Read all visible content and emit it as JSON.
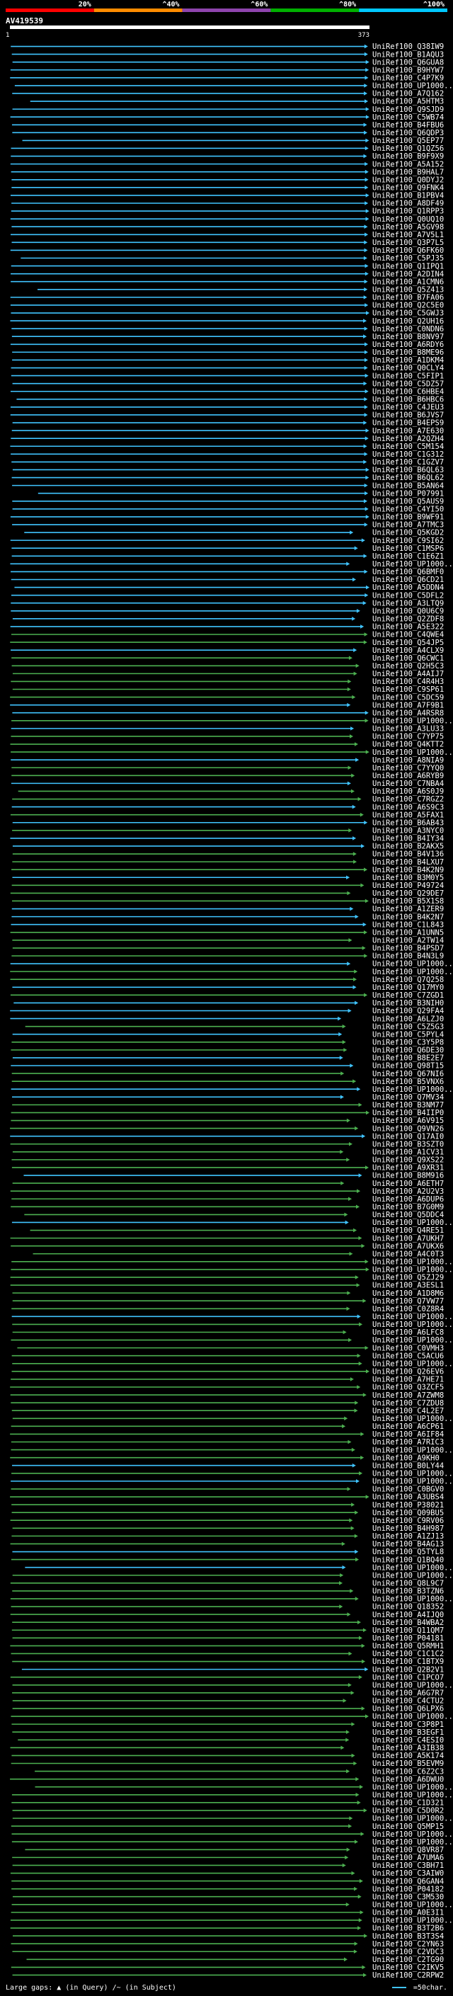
{
  "query_name": "AV419539",
  "query_start": "1",
  "query_end": "373",
  "scale_labels": [
    "20%",
    "^40%",
    "^60%",
    "^80%",
    "^100%"
  ],
  "scale_colors": [
    "#ff0000",
    "#ff8c00",
    "#8e44ad",
    "#00b000",
    "#00c8ff"
  ],
  "hit_colors": {
    "high": "#40c4ff",
    "mid": "#4caf50"
  },
  "footer": {
    "gaps_label": "Large gaps:",
    "gap_query_label": "(in Query)",
    "gap_subject_label": "(in Subject)",
    "key_label": "=50char."
  },
  "hits": [
    "UniRef100_Q38IW9",
    "UniRef100_B1AQU3",
    "UniRef100_Q6GUA8",
    "UniRef100_B9HYW7",
    "UniRef100_C4P7K9",
    "UniRef100_UP1000...",
    "UniRef100_A7Q162",
    "UniRef100_A5HTM3",
    "UniRef100_Q9SJD9",
    "UniRef100_C5WB74",
    "UniRef100_B4FBU6",
    "UniRef100_Q6QDP3",
    "UniRef100_Q5EP77",
    "UniRef100_Q1QZ56",
    "UniRef100_B9F9X9",
    "UniRef100_A5A152",
    "UniRef100_B9HAL7",
    "UniRef100_Q0DYJ2",
    "UniRef100_Q9FNK4",
    "UniRef100_B1PBV4",
    "UniRef100_A8DF49",
    "UniRef100_Q1RPP3",
    "UniRef100_Q0UQ10",
    "UniRef100_A5GV98",
    "UniRef100_A7V5L1",
    "UniRef100_Q3P7L5",
    "UniRef100_Q6FK60",
    "UniRef100_C5PJ35",
    "UniRef100_Q1IPQ1",
    "UniRef100_A2DIN4",
    "UniRef100_A1CMN6",
    "UniRef100_Q5Z413",
    "UniRef100_B7FA06",
    "UniRef100_Q2C5E0",
    "UniRef100_C5GWJ3",
    "UniRef100_Q2UH16",
    "UniRef100_C0NDN6",
    "UniRef100_B8NV97",
    "UniRef100_A6RDY6",
    "UniRef100_B8ME96",
    "UniRef100_A1DKM4",
    "UniRef100_Q0CLY4",
    "UniRef100_C5FIP1",
    "UniRef100_C5DZ57",
    "UniRef100_C6HBE4",
    "UniRef100_B6HBC6",
    "UniRef100_C4JEU3",
    "UniRef100_B6JVS7",
    "UniRef100_B4EPS9",
    "UniRef100_A7E630",
    "UniRef100_A2QZH4",
    "UniRef100_C5M154",
    "UniRef100_C1G312",
    "UniRef100_C1GZV7",
    "UniRef100_B6QL63",
    "UniRef100_B6QL62",
    "UniRef100_B5AN64",
    "UniRef100_P07991",
    "UniRef100_Q5AUS9",
    "UniRef100_C4YI50",
    "UniRef100_B9WF91",
    "UniRef100_A7TMC3",
    "UniRef100_Q5KGD2",
    "UniRef100_C9SI62",
    "UniRef100_C1MSP6",
    "UniRef100_C1E6Z1",
    "UniRef100_UP1000...",
    "UniRef100_Q6BMF0",
    "UniRef100_Q6CD21",
    "UniRef100_A5DDN4",
    "UniRef100_C5DFL2",
    "UniRef100_A3LTQ9",
    "UniRef100_Q0U6C9",
    "UniRef100_Q2ZDF8",
    "UniRef100_A5E322",
    "UniRef100_C4QWE4",
    "UniRef100_Q54JP5",
    "UniRef100_A4CLX9",
    "UniRef100_Q6CWC1",
    "UniRef100_Q2H5C3",
    "UniRef100_A4AIJ7",
    "UniRef100_C4R4H3",
    "UniRef100_C9SP61",
    "UniRef100_C5DC59",
    "UniRef100_A7F9B1",
    "UniRef100_A4RSR8",
    "UniRef100_UP1000...",
    "UniRef100_A3LU33",
    "UniRef100_C7YP75",
    "UniRef100_Q4KTT2",
    "UniRef100_UP1000...",
    "UniRef100_A8NIA9",
    "UniRef100_C7YYQ0",
    "UniRef100_A6RYB9",
    "UniRef100_C7NBA4",
    "UniRef100_A6S0J9",
    "UniRef100_C7RGZ2",
    "UniRef100_A6S9C3",
    "UniRef100_A5FAX1",
    "UniRef100_B6AB43",
    "UniRef100_A3NYC0",
    "UniRef100_B4IY34",
    "UniRef100_B2AKX5",
    "UniRef100_B4V136",
    "UniRef100_B4LXU7",
    "UniRef100_B4K2N9",
    "UniRef100_B3M0Y5",
    "UniRef100_P49724",
    "UniRef100_Q29DE7",
    "UniRef100_B5X1S8",
    "UniRef100_A1ZER9",
    "UniRef100_B4K2N7",
    "UniRef100_C1L843",
    "UniRef100_A1UNN5",
    "UniRef100_A2TW14",
    "UniRef100_B4PSD7",
    "UniRef100_B4N3L9",
    "UniRef100_UP1000...",
    "UniRef100_UP1000...",
    "UniRef100_Q7Q258",
    "UniRef100_Q17MY0",
    "UniRef100_C7ZGD1",
    "UniRef100_B3NIH0",
    "UniRef100_Q29FA4",
    "UniRef100_A6LZJ0",
    "UniRef100_C5Z5G3",
    "UniRef100_C5PYL4",
    "UniRef100_C3Y5P8",
    "UniRef100_Q6DE30",
    "UniRef100_B8E2E7",
    "UniRef100_Q98T15",
    "UniRef100_Q67NI6",
    "UniRef100_B5VNX6",
    "UniRef100_UP1000...",
    "UniRef100_Q7MV34",
    "UniRef100_B3NM77",
    "UniRef100_B4IIP0",
    "UniRef100_A6V915",
    "UniRef100_Q9VN26",
    "UniRef100_Q17AI0",
    "UniRef100_B3SZT0",
    "UniRef100_A1CV31",
    "UniRef100_Q9XS22",
    "UniRef100_A9XR31",
    "UniRef100_B8M916",
    "UniRef100_A6ETH7",
    "UniRef100_A2U2V3",
    "UniRef100_A6DUP6",
    "UniRef100_B7G0M9",
    "UniRef100_Q5DDC4",
    "UniRef100_UP1000...",
    "UniRef100_Q4RE51",
    "UniRef100_A7UKH7",
    "UniRef100_A7UKX6",
    "UniRef100_A4C0T3",
    "UniRef100_UP1000...",
    "UniRef100_UP1000...",
    "UniRef100_Q5ZJ29",
    "UniRef100_A3ESL1",
    "UniRef100_A1D8M6",
    "UniRef100_Q7VW77",
    "UniRef100_C0Z8R4",
    "UniRef100_UP1000...",
    "UniRef100_UP1000...",
    "UniRef100_A6LFC8",
    "UniRef100_UP1000...",
    "UniRef100_C0VMH3",
    "UniRef100_C5ACU6",
    "UniRef100_UP1000...",
    "UniRef100_Q26EV6",
    "UniRef100_A7HE71",
    "UniRef100_Q3ZCF5",
    "UniRef100_A7ZWM8",
    "UniRef100_C7ZDU8",
    "UniRef100_C4L2E7",
    "UniRef100_UP1000...",
    "UniRef100_A6CP61",
    "UniRef100_A6IF84",
    "UniRef100_A7RIC3",
    "UniRef100_UP1000...",
    "UniRef100_A9KH0",
    "UniRef100_B0LY44",
    "UniRef100_UP1000...",
    "UniRef100_UP1000...",
    "UniRef100_C0BGV0",
    "UniRef100_A3UBS4",
    "UniRef100_P38021",
    "UniRef100_Q09BU5",
    "UniRef100_C9RV06",
    "UniRef100_B4H987",
    "UniRef100_A1ZJ13",
    "UniRef100_B4AG13",
    "UniRef100_Q5TYL8",
    "UniRef100_Q1BQ40",
    "UniRef100_UP1000...",
    "UniRef100_UP1000...",
    "UniRef100_Q8L9C7",
    "UniRef100_B3TZN6",
    "UniRef100_UP1000...",
    "UniRef100_Q18352",
    "UniRef100_A4IJQ0",
    "UniRef100_B4WBA2",
    "UniRef100_Q11QM7",
    "UniRef100_P04181",
    "UniRef100_Q5RMH1",
    "UniRef100_C1C1C2",
    "UniRef100_C1BTX9",
    "UniRef100_Q2B2V1",
    "UniRef100_C1PCO7",
    "UniRef100_UP1000...",
    "UniRef100_A6G7R7",
    "UniRef100_C4CTU2",
    "UniRef100_Q6LPX6",
    "UniRef100_UP1000...",
    "UniRef100_C3P8P1",
    "UniRef100_B3EGF1",
    "UniRef100_C4ESI0",
    "UniRef100_A3IB38",
    "UniRef100_A5K174",
    "UniRef100_B5EVM9",
    "UniRef100_C6Z2C3",
    "UniRef100_A6DWU0",
    "UniRef100_UP1000...",
    "UniRef100_UP1000...",
    "UniRef100_C1D321",
    "UniRef100_C5D0R2",
    "UniRef100_UP1000...",
    "UniRef100_Q5MP15",
    "UniRef100_UP1000...",
    "UniRef100_UP1000...",
    "UniRef100_Q8VR87",
    "UniRef100_A7UMA6",
    "UniRef100_C3BH71",
    "UniRef100_C3AIW0",
    "UniRef100_Q6GAN4",
    "UniRef100_P04182",
    "UniRef100_C3M530",
    "UniRef100_UP1000...",
    "UniRef100_A0E3I1",
    "UniRef100_UP1000...",
    "UniRef100_B3T2B6",
    "UniRef100_B3T3S4",
    "UniRef100_C2YN63",
    "UniRef100_C2VDC3",
    "UniRef100_C2TG90",
    "UniRef100_C2IKV5",
    "UniRef100_C2RPW2"
  ]
}
